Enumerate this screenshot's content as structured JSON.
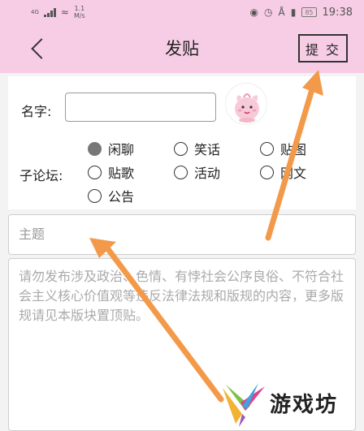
{
  "status_bar": {
    "network": "4G",
    "speed_value": "1.1",
    "speed_unit": "M/s",
    "battery": "85",
    "time": "19:38"
  },
  "header": {
    "title": "发贴",
    "submit_label": "提 交"
  },
  "form": {
    "name_label": "名字:",
    "name_value": "",
    "forum_label": "子论坛:",
    "forums": [
      {
        "label": "闲聊",
        "checked": true
      },
      {
        "label": "笑话",
        "checked": false
      },
      {
        "label": "贴图",
        "checked": false
      },
      {
        "label": "贴歌",
        "checked": false
      },
      {
        "label": "活动",
        "checked": false
      },
      {
        "label": "网文",
        "checked": false
      },
      {
        "label": "公告",
        "checked": false
      }
    ],
    "subject_placeholder": "主题",
    "content_placeholder": "请勿发布涉及政治、色情、有悖社会公序良俗、不符合社会主义核心价值观等违反法律法规和版规的内容，更多版规请见本版块置顶贴。"
  },
  "watermark": {
    "text": "游戏坊"
  },
  "colors": {
    "header_bg": "#f7cde6",
    "arrow": "#f39a4a",
    "radio_selected": "#777777"
  },
  "icons": {
    "back": "chevron-left-icon",
    "avatar": "pink-creature-avatar-icon"
  }
}
